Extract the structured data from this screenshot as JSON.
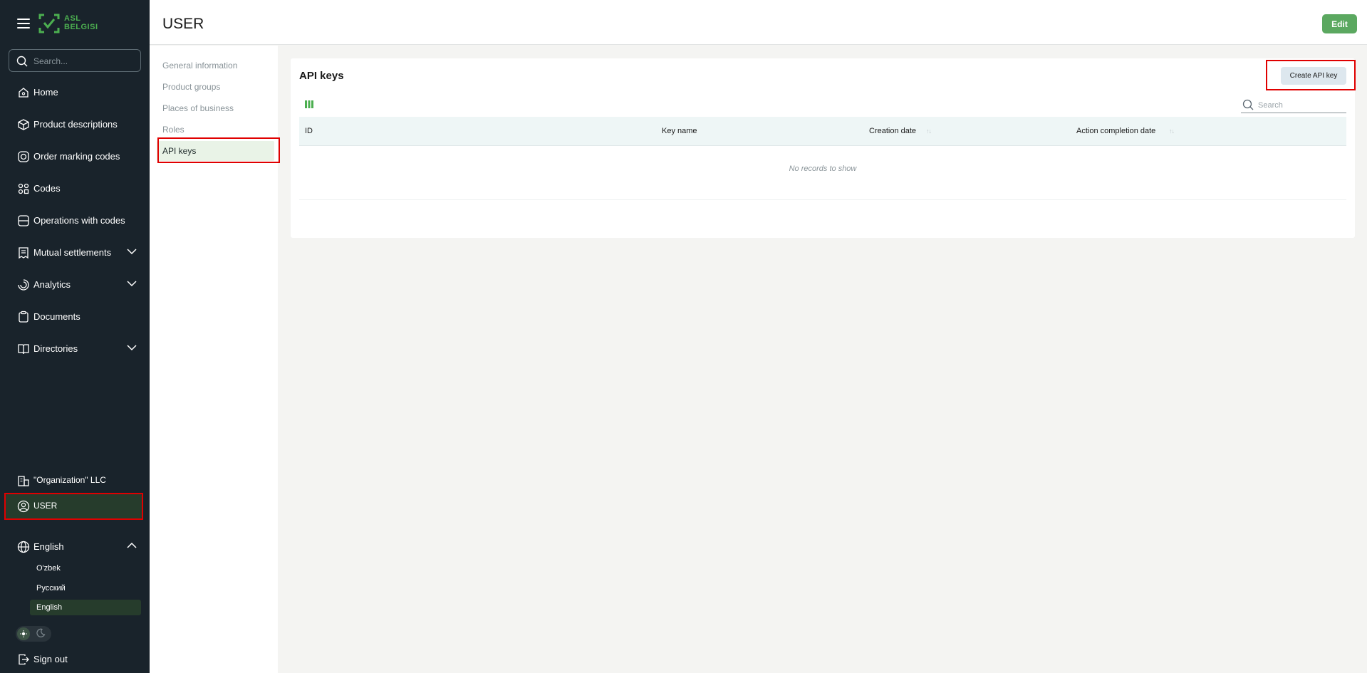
{
  "app": {
    "logo_text_line1": "ASL",
    "logo_text_line2": "BELGISI",
    "brand_color": "#4caf50"
  },
  "sidebar": {
    "search_placeholder": "Search...",
    "items": [
      {
        "label": "Home",
        "icon": "home-icon"
      },
      {
        "label": "Product descriptions",
        "icon": "box-icon"
      },
      {
        "label": "Order marking codes",
        "icon": "order-codes-icon"
      },
      {
        "label": "Codes",
        "icon": "codes-icon"
      },
      {
        "label": "Operations with codes",
        "icon": "operations-icon"
      },
      {
        "label": "Mutual settlements",
        "icon": "receipt-icon"
      },
      {
        "label": "Analytics",
        "icon": "analytics-icon"
      },
      {
        "label": "Documents",
        "icon": "clipboard-icon"
      },
      {
        "label": "Directories",
        "icon": "book-icon"
      }
    ],
    "organization": "\"Organization\" LLC",
    "user": "USER",
    "language": {
      "label": "English",
      "options": [
        "O'zbek",
        "Русский",
        "English"
      ],
      "selected": "English"
    },
    "sign_out": "Sign out"
  },
  "header": {
    "title": "USER",
    "edit_label": "Edit"
  },
  "subnav": {
    "items": [
      "General information",
      "Product groups",
      "Places of business",
      "Roles",
      "API keys"
    ],
    "active": "API keys"
  },
  "api_keys": {
    "title": "API keys",
    "create_label": "Create API key",
    "search_placeholder": "Search",
    "columns": [
      "ID",
      "Key name",
      "Creation date",
      "Action completion date"
    ],
    "empty_text": "No records to show"
  },
  "colors": {
    "sidebar_bg": "#19232b",
    "accent": "#5ba860",
    "highlight": "#e00000"
  }
}
